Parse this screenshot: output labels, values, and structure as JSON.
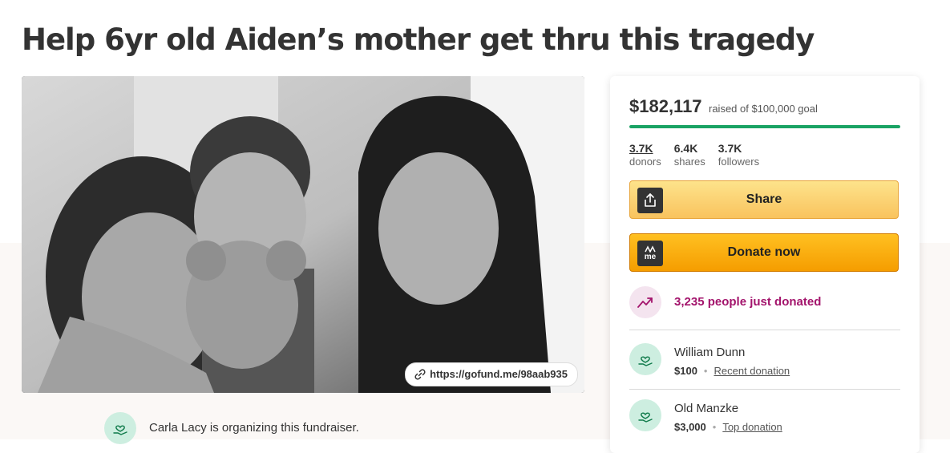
{
  "page": {
    "title": "Help 6yr old Aiden’s mother get thru this tragedy"
  },
  "photo": {
    "alt": "",
    "link_text": "https://gofund.me/98aab935",
    "link_icon": "link-icon"
  },
  "organizer": {
    "text": "Carla Lacy is organizing this fundraiser.",
    "icon": "heart-hand-icon"
  },
  "card": {
    "amount": "$182,117",
    "goal_text": "raised of $100,000 goal",
    "progress_percent": 100,
    "progress_color": "#1aa364",
    "stats": [
      {
        "value": "3.7K",
        "label": "donors"
      },
      {
        "value": "6.4K",
        "label": "shares"
      },
      {
        "value": "3.7K",
        "label": "followers"
      }
    ],
    "share_label": "Share",
    "share_icon": "share-upload-icon",
    "donate_label": "Donate now",
    "donate_icon_text": "me",
    "trend_icon": "trending-up-icon",
    "trend_text": "3,235 people just donated",
    "trend_color": "#a3146c",
    "donations": [
      {
        "name": "William Dunn",
        "amount": "$100",
        "tag": "Recent donation"
      },
      {
        "name": "Old Manzke",
        "amount": "$3,000",
        "tag": "Top donation"
      }
    ]
  }
}
